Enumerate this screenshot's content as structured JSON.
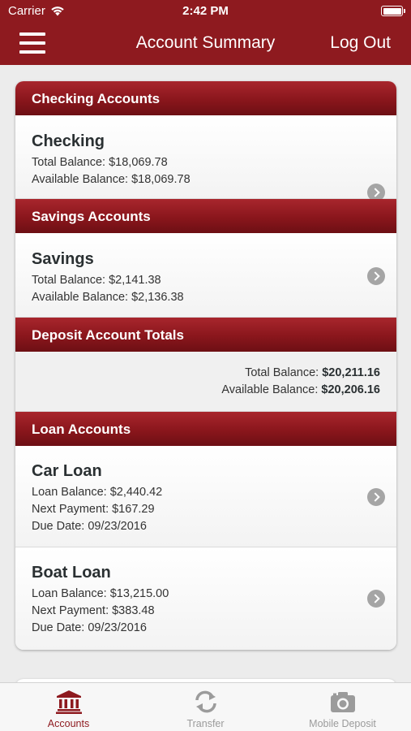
{
  "status_bar": {
    "carrier": "Carrier",
    "time": "2:42 PM"
  },
  "nav": {
    "title": "Account Summary",
    "logout": "Log Out"
  },
  "sections": {
    "checking": {
      "title": "Checking Accounts"
    },
    "savings": {
      "title": "Savings Accounts"
    },
    "totals": {
      "title": "Deposit Account Totals"
    },
    "loans": {
      "title": "Loan Accounts"
    }
  },
  "accounts": {
    "checking": {
      "name": "Checking",
      "total": "Total Balance: $18,069.78",
      "available": "Available Balance: $18,069.78"
    },
    "savings": {
      "name": "Savings",
      "total": "Total Balance: $2,141.38",
      "available": "Available Balance: $2,136.38"
    }
  },
  "totals": {
    "total_label": "Total Balance:",
    "total_value": "$20,211.16",
    "available_label": "Available Balance:",
    "available_value": "$20,206.16"
  },
  "loans": {
    "car": {
      "name": "Car Loan",
      "balance": "Loan Balance: $2,440.42",
      "payment": "Next Payment: $167.29",
      "due": "Due Date: 09/23/2016"
    },
    "boat": {
      "name": "Boat Loan",
      "balance": "Loan Balance: $13,215.00",
      "payment": "Next Payment: $383.48",
      "due": "Due Date: 09/23/2016"
    }
  },
  "tabs": [
    {
      "label": "Accounts",
      "icon": "bank-icon",
      "active": true
    },
    {
      "label": "Transfer",
      "icon": "transfer-icon",
      "active": false
    },
    {
      "label": "Mobile Deposit",
      "icon": "camera-icon",
      "active": false
    }
  ],
  "colors": {
    "brand": "#8e1a1f",
    "tab_inactive": "#9b9b9b"
  }
}
